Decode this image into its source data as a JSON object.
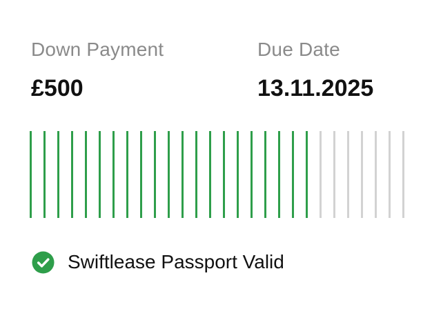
{
  "down_payment": {
    "label": "Down Payment",
    "value": "£500"
  },
  "due_date": {
    "label": "Due Date",
    "value": "13.11.2025"
  },
  "progress": {
    "total_ticks": 28,
    "filled_ticks": 21,
    "filled_color": "#2e9e4a",
    "empty_color": "#d2d2d2"
  },
  "status": {
    "icon": "check-circle-icon",
    "icon_color": "#2e9e4a",
    "text": "Swiftlease Passport Valid"
  }
}
